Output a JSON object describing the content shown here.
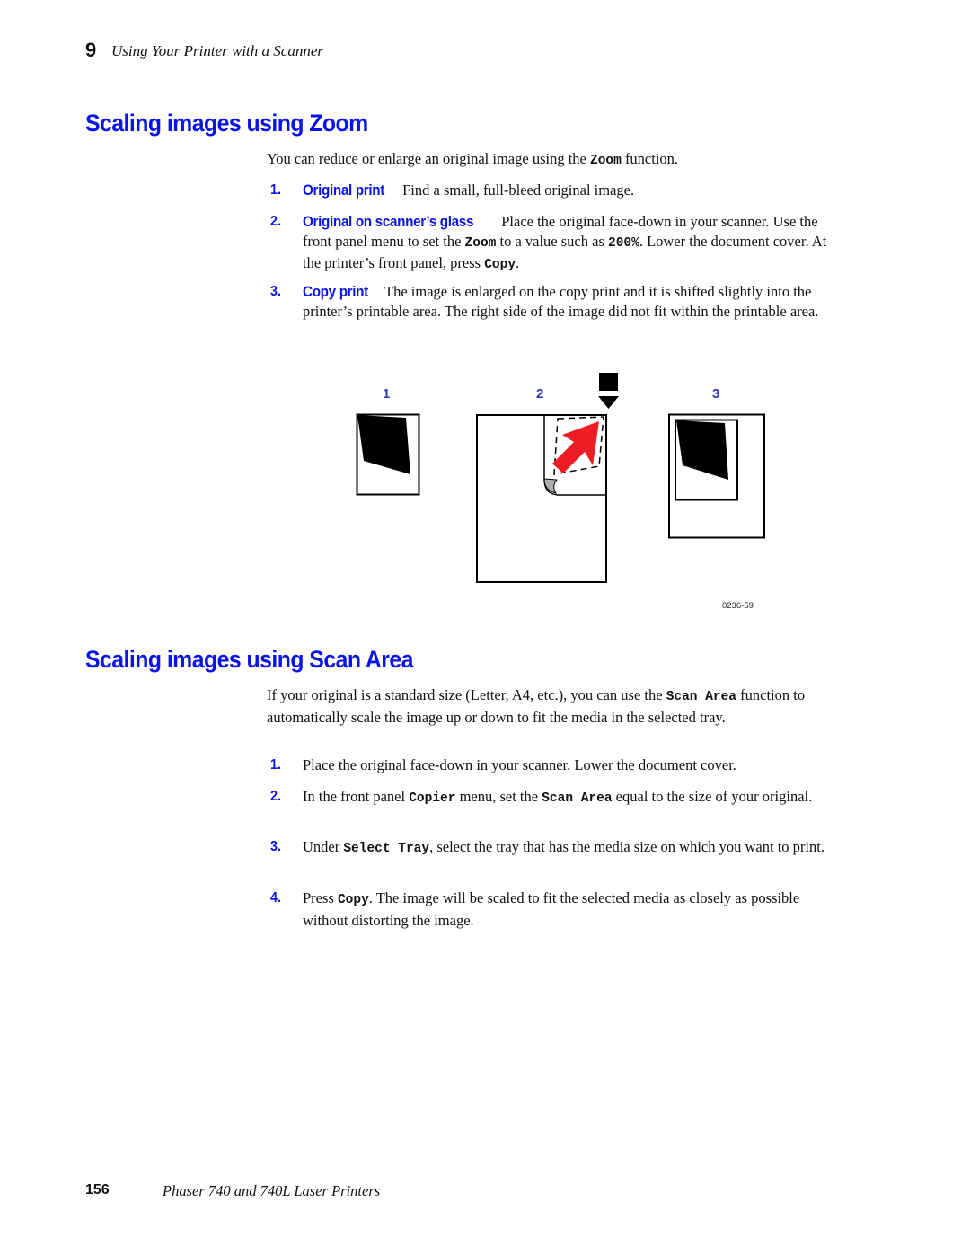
{
  "header": {
    "chapter_number": "9",
    "chapter_title": "Using Your Printer with a Scanner"
  },
  "section_zoom": {
    "heading": "Scaling images using Zoom",
    "intro": [
      "You can reduce or enlarge an original image using the ",
      "Zoom",
      " function."
    ],
    "steps": [
      {
        "number": "1.",
        "lead": "Original print",
        "text": "Find a small, full-bleed original image."
      },
      {
        "number": "2.",
        "lead": "Original on scanner’s glass",
        "parts": [
          "Place the original face-down in your scanner. Use the front panel menu to set the ",
          "Zoom",
          " to a value such as ",
          "200%",
          ".  Lower the document cover.  At the printer’s front panel, press ",
          "Copy",
          "."
        ]
      },
      {
        "number": "3.",
        "lead": "Copy print",
        "text": "The image is enlarged on the copy print and it is shifted slightly into the printer’s printable area. The right side of the image did not fit within the printable area."
      }
    ]
  },
  "figure": {
    "labels": [
      "1",
      "2",
      "3"
    ],
    "code": "0236-59",
    "colors": {
      "arrow": "#ee1c24",
      "label": "#2a3ab8",
      "curl": "#b0b0b0"
    }
  },
  "section_scan": {
    "heading": "Scaling images using Scan Area",
    "intro": [
      "If your original is a standard size (Letter, A4, etc.), you can use the ",
      "Scan Area",
      " function to automatically scale the image up or down to fit the media in the selected tray."
    ],
    "steps": [
      {
        "number": "1.",
        "parts": [
          "Place the original face-down in your scanner.  Lower the document cover."
        ]
      },
      {
        "number": "2.",
        "parts": [
          "In the front panel ",
          "Copier",
          " menu, set the ",
          "Scan Area",
          " equal to the size of your original."
        ]
      },
      {
        "number": "3.",
        "parts": [
          "Under ",
          "Select Tray",
          ", select the tray that has the media size on which you want to print."
        ]
      },
      {
        "number": "4.",
        "parts": [
          "Press ",
          "Copy",
          ".  The image will be scaled to fit the selected media as closely as possible without distorting the image."
        ]
      }
    ]
  },
  "footer": {
    "page_number": "156",
    "book_title": "Phaser 740 and 740L Laser Printers"
  },
  "colors": {
    "heading_blue": "#0a14e6"
  }
}
